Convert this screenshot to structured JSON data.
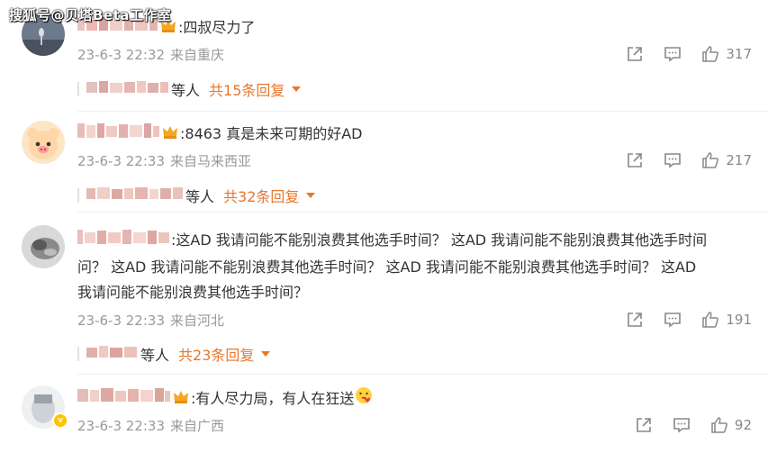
{
  "watermark": "搜狐号@贝塔Beta工作室",
  "comments": [
    {
      "text": ":四叔尽力了",
      "time": "23-6-3 22:32",
      "location": "来自重庆",
      "likes": "317",
      "replies": {
        "etc": "等人",
        "total": "共15条回复"
      }
    },
    {
      "text": ":8463 真是未来可期的好AD",
      "time": "23-6-3 22:33",
      "location": "来自马来西亚",
      "likes": "217",
      "replies": {
        "etc": "等人",
        "total": "共32条回复"
      }
    },
    {
      "text_line1": ":这AD 我请问能不能别浪费其他选手时间？ 这AD 我请问能不能别浪费其他选手时间",
      "text_line2": "问？ 这AD 我请问能不能别浪费其他选手时间？ 这AD 我请问能不能别浪费其他选手时间？ 这AD",
      "text_line3": "我请问能不能别浪费其他选手时间？",
      "time": "23-6-3 22:33",
      "location": "来自河北",
      "likes": "191",
      "replies": {
        "etc": "等人",
        "total": "共23条回复"
      }
    },
    {
      "text": ":有人尽力局，有人在狂送",
      "time": "23-6-3 22:33",
      "location": "来自广西",
      "likes": "92"
    }
  ],
  "colors": {
    "accent": "#e8762d",
    "meta": "#999999",
    "text": "#333333"
  },
  "icons": [
    "share-icon",
    "comment-icon",
    "like-icon",
    "crown-icon",
    "chevron-down-icon"
  ]
}
